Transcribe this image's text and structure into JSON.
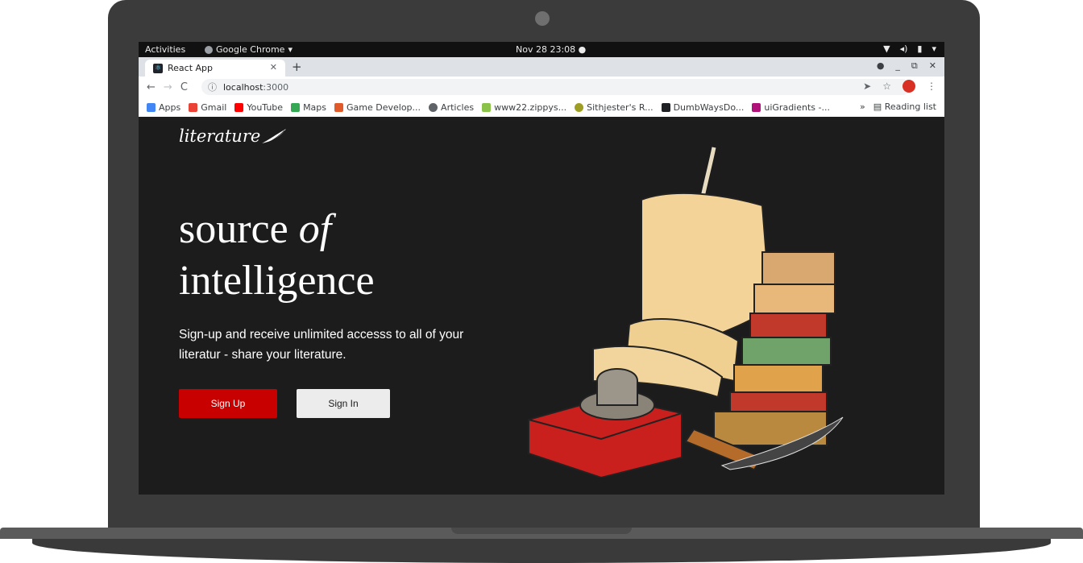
{
  "os": {
    "activities": "Activities",
    "app_name": "Google Chrome",
    "clock": "Nov 28  23:08"
  },
  "browser": {
    "tab_title": "React App",
    "url_host": "localhost",
    "url_port": ":3000",
    "bookmarks": [
      {
        "label": "Apps",
        "color": "#4285f4"
      },
      {
        "label": "Gmail",
        "color": "#ea4335"
      },
      {
        "label": "YouTube",
        "color": "#ff0000"
      },
      {
        "label": "Maps",
        "color": "#34a853"
      },
      {
        "label": "Game Develop...",
        "color": "#e05a2a"
      },
      {
        "label": "Articles",
        "color": "#5f6368"
      },
      {
        "label": "www22.zippys...",
        "color": "#8bc34a"
      },
      {
        "label": "Sithjester's R...",
        "color": "#9e9d24"
      },
      {
        "label": "DumbWaysDo...",
        "color": "#202124"
      },
      {
        "label": "uiGradients -...",
        "color": "#b0127a"
      }
    ],
    "reading_list": "Reading list"
  },
  "page": {
    "logo": "literature",
    "headline_line1_start": "source ",
    "headline_line1_em": "of",
    "headline_line2": "intelligence",
    "subtext": "Sign-up and receive unlimited accesss to all of your literatur - share your literature.",
    "signup_label": "Sign Up",
    "signin_label": "Sign In"
  },
  "colors": {
    "page_bg": "#1c1c1c",
    "accent_red": "#c80000",
    "signin_bg": "#ececec"
  }
}
